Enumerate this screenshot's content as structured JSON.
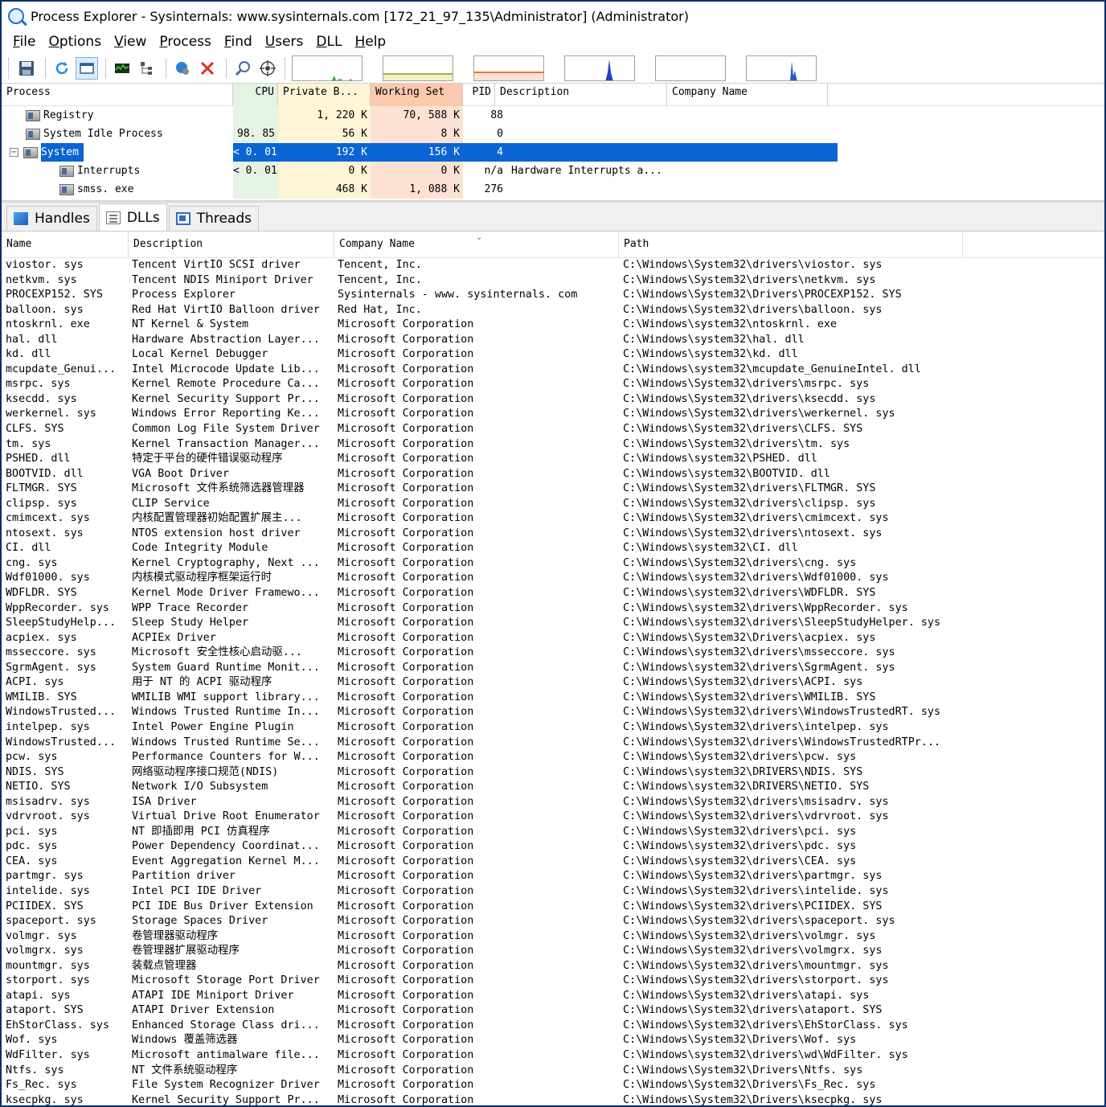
{
  "window": {
    "title": "Process Explorer - Sysinternals: www.sysinternals.com [172_21_97_135\\Administrator] (Administrator)"
  },
  "menu": [
    "File",
    "Options",
    "View",
    "Process",
    "Find",
    "Users",
    "DLL",
    "Help"
  ],
  "toolbar": {
    "icons": [
      "save-icon",
      "refresh-icon",
      "window-icon",
      "system-info-icon",
      "tree-icon",
      "properties-icon",
      "kill-process-icon",
      "find-icon",
      "target-icon"
    ]
  },
  "process_table": {
    "columns": [
      "Process",
      "CPU",
      "Private B...",
      "Working Set",
      "PID",
      "Description",
      "Company Name"
    ],
    "rows": [
      {
        "name": "Registry",
        "cpu": "",
        "private": "1, 220  K",
        "ws": "70, 588  K",
        "pid": "88",
        "desc": "",
        "company": "",
        "indent": 1,
        "selected": false,
        "expander": ""
      },
      {
        "name": "System Idle Process",
        "cpu": "98. 85",
        "private": "56  K",
        "ws": "8  K",
        "pid": "0",
        "desc": "",
        "company": "",
        "indent": 1,
        "selected": false,
        "expander": ""
      },
      {
        "name": "System",
        "cpu": "< 0. 01",
        "private": "192  K",
        "ws": "156  K",
        "pid": "4",
        "desc": "",
        "company": "",
        "indent": 1,
        "selected": true,
        "expander": "−"
      },
      {
        "name": "Interrupts",
        "cpu": "< 0. 01",
        "private": "0  K",
        "ws": "0  K",
        "pid": "n/a",
        "desc": "Hardware Interrupts a...",
        "company": "",
        "indent": 2,
        "selected": false,
        "expander": ""
      },
      {
        "name": "smss. exe",
        "cpu": "",
        "private": "468  K",
        "ws": "1, 088  K",
        "pid": "276",
        "desc": "",
        "company": "",
        "indent": 2,
        "selected": false,
        "expander": ""
      }
    ]
  },
  "tabs": [
    {
      "label": "Handles",
      "active": false
    },
    {
      "label": "DLLs",
      "active": true
    },
    {
      "label": "Threads",
      "active": false
    }
  ],
  "dll_table": {
    "columns": [
      "Name",
      "Description",
      "Company Name",
      "Path"
    ],
    "rows": [
      [
        "viostor. sys",
        "Tencent VirtIO SCSI driver",
        "Tencent,  Inc.",
        "C:\\Windows\\System32\\drivers\\viostor. sys"
      ],
      [
        "netkvm. sys",
        "Tencent NDIS Miniport Driver",
        "Tencent,  Inc.",
        "C:\\Windows\\System32\\drivers\\netkvm. sys"
      ],
      [
        "PROCEXP152. SYS",
        "Process Explorer",
        "Sysinternals - www. sysinternals. com",
        "C:\\Windows\\System32\\Drivers\\PROCEXP152. SYS"
      ],
      [
        "balloon. sys",
        "Red Hat VirtIO Balloon driver",
        "Red Hat,  Inc.",
        "C:\\Windows\\System32\\drivers\\balloon. sys"
      ],
      [
        "ntoskrnl. exe",
        "NT Kernel & System",
        "Microsoft Corporation",
        "C:\\Windows\\system32\\ntoskrnl. exe"
      ],
      [
        "hal. dll",
        "Hardware Abstraction Layer...",
        "Microsoft Corporation",
        "C:\\Windows\\system32\\hal. dll"
      ],
      [
        "kd. dll",
        "Local Kernel Debugger",
        "Microsoft Corporation",
        "C:\\Windows\\system32\\kd. dll"
      ],
      [
        "mcupdate_Genui...",
        "Intel Microcode Update Lib...",
        "Microsoft Corporation",
        "C:\\Windows\\system32\\mcupdate_GenuineIntel. dll"
      ],
      [
        "msrpc. sys",
        "Kernel Remote Procedure Ca...",
        "Microsoft Corporation",
        "C:\\Windows\\System32\\drivers\\msrpc. sys"
      ],
      [
        "ksecdd. sys",
        "Kernel Security Support Pr...",
        "Microsoft Corporation",
        "C:\\Windows\\System32\\drivers\\ksecdd. sys"
      ],
      [
        "werkernel. sys",
        "Windows Error Reporting Ke...",
        "Microsoft Corporation",
        "C:\\Windows\\System32\\drivers\\werkernel. sys"
      ],
      [
        "CLFS. SYS",
        "Common Log File System Driver",
        "Microsoft Corporation",
        "C:\\Windows\\System32\\drivers\\CLFS. SYS"
      ],
      [
        "tm. sys",
        "Kernel Transaction Manager...",
        "Microsoft Corporation",
        "C:\\Windows\\System32\\drivers\\tm. sys"
      ],
      [
        "PSHED. dll",
        "特定于平台的硬件错误驱动程序",
        "Microsoft Corporation",
        "C:\\Windows\\system32\\PSHED. dll"
      ],
      [
        "BOOTVID. dll",
        "VGA Boot Driver",
        "Microsoft Corporation",
        "C:\\Windows\\system32\\BOOTVID. dll"
      ],
      [
        "FLTMGR. SYS",
        "Microsoft 文件系统筛选器管理器",
        "Microsoft Corporation",
        "C:\\Windows\\System32\\drivers\\FLTMGR. SYS"
      ],
      [
        "clipsp. sys",
        "CLIP Service",
        "Microsoft Corporation",
        "C:\\Windows\\System32\\drivers\\clipsp. sys"
      ],
      [
        "cmimcext. sys",
        "内核配置管理器初始配置扩展主...",
        "Microsoft Corporation",
        "C:\\Windows\\System32\\drivers\\cmimcext. sys"
      ],
      [
        "ntosext. sys",
        "NTOS extension host driver",
        "Microsoft Corporation",
        "C:\\Windows\\System32\\drivers\\ntosext. sys"
      ],
      [
        "CI. dll",
        "Code Integrity Module",
        "Microsoft Corporation",
        "C:\\Windows\\system32\\CI. dll"
      ],
      [
        "cng. sys",
        "Kernel Cryptography,  Next ...",
        "Microsoft Corporation",
        "C:\\Windows\\System32\\drivers\\cng. sys"
      ],
      [
        "Wdf01000. sys",
        "内核模式驱动程序框架运行时",
        "Microsoft Corporation",
        "C:\\Windows\\system32\\drivers\\Wdf01000. sys"
      ],
      [
        "WDFLDR. SYS",
        "Kernel Mode Driver Framewo...",
        "Microsoft Corporation",
        "C:\\Windows\\system32\\drivers\\WDFLDR. SYS"
      ],
      [
        "WppRecorder. sys",
        "WPP Trace Recorder",
        "Microsoft Corporation",
        "C:\\Windows\\system32\\drivers\\WppRecorder. sys"
      ],
      [
        "SleepStudyHelp...",
        "Sleep Study Helper",
        "Microsoft Corporation",
        "C:\\Windows\\system32\\drivers\\SleepStudyHelper. sys"
      ],
      [
        "acpiex. sys",
        "ACPIEx Driver",
        "Microsoft Corporation",
        "C:\\Windows\\System32\\Drivers\\acpiex. sys"
      ],
      [
        "msseccore. sys",
        "Microsoft 安全性核心启动驱...",
        "Microsoft Corporation",
        "C:\\Windows\\system32\\drivers\\msseccore. sys"
      ],
      [
        "SgrmAgent. sys",
        "System Guard Runtime Monit...",
        "Microsoft Corporation",
        "C:\\Windows\\system32\\drivers\\SgrmAgent. sys"
      ],
      [
        "ACPI. sys",
        "用于 NT 的 ACPI 驱动程序",
        "Microsoft Corporation",
        "C:\\Windows\\System32\\drivers\\ACPI. sys"
      ],
      [
        "WMILIB. SYS",
        "WMILIB WMI support library...",
        "Microsoft Corporation",
        "C:\\Windows\\System32\\drivers\\WMILIB. SYS"
      ],
      [
        "WindowsTrusted...",
        "Windows Trusted Runtime In...",
        "Microsoft Corporation",
        "C:\\Windows\\System32\\drivers\\WindowsTrustedRT. sys"
      ],
      [
        "intelpep. sys",
        "Intel Power Engine Plugin",
        "Microsoft Corporation",
        "C:\\Windows\\System32\\drivers\\intelpep. sys"
      ],
      [
        "WindowsTrusted...",
        "Windows Trusted Runtime Se...",
        "Microsoft Corporation",
        "C:\\Windows\\System32\\drivers\\WindowsTrustedRTPr..."
      ],
      [
        "pcw. sys",
        "Performance Counters for W...",
        "Microsoft Corporation",
        "C:\\Windows\\System32\\drivers\\pcw. sys"
      ],
      [
        "NDIS. SYS",
        "网络驱动程序接口规范(NDIS)",
        "Microsoft Corporation",
        "C:\\Windows\\system32\\DRIVERS\\NDIS. SYS"
      ],
      [
        "NETIO. SYS",
        "Network I/O Subsystem",
        "Microsoft Corporation",
        "C:\\Windows\\system32\\DRIVERS\\NETIO. SYS"
      ],
      [
        "msisadrv. sys",
        "ISA Driver",
        "Microsoft Corporation",
        "C:\\Windows\\System32\\drivers\\msisadrv. sys"
      ],
      [
        "vdrvroot. sys",
        "Virtual Drive Root Enumerator",
        "Microsoft Corporation",
        "C:\\Windows\\System32\\drivers\\vdrvroot. sys"
      ],
      [
        "pci. sys",
        "NT 即插即用 PCI 仿真程序",
        "Microsoft Corporation",
        "C:\\Windows\\System32\\drivers\\pci. sys"
      ],
      [
        "pdc. sys",
        "Power Dependency Coordinat...",
        "Microsoft Corporation",
        "C:\\Windows\\system32\\drivers\\pdc. sys"
      ],
      [
        "CEA. sys",
        "Event Aggregation Kernel M...",
        "Microsoft Corporation",
        "C:\\Windows\\system32\\drivers\\CEA. sys"
      ],
      [
        "partmgr. sys",
        "Partition driver",
        "Microsoft Corporation",
        "C:\\Windows\\System32\\drivers\\partmgr. sys"
      ],
      [
        "intelide. sys",
        "Intel PCI IDE Driver",
        "Microsoft Corporation",
        "C:\\Windows\\System32\\drivers\\intelide. sys"
      ],
      [
        "PCIIDEX. SYS",
        "PCI IDE Bus Driver Extension",
        "Microsoft Corporation",
        "C:\\Windows\\System32\\drivers\\PCIIDEX. SYS"
      ],
      [
        "spaceport. sys",
        "Storage Spaces Driver",
        "Microsoft Corporation",
        "C:\\Windows\\System32\\drivers\\spaceport. sys"
      ],
      [
        "volmgr. sys",
        "卷管理器驱动程序",
        "Microsoft Corporation",
        "C:\\Windows\\System32\\drivers\\volmgr. sys"
      ],
      [
        "volmgrx. sys",
        "卷管理器扩展驱动程序",
        "Microsoft Corporation",
        "C:\\Windows\\System32\\drivers\\volmgrx. sys"
      ],
      [
        "mountmgr. sys",
        "装载点管理器",
        "Microsoft Corporation",
        "C:\\Windows\\System32\\drivers\\mountmgr. sys"
      ],
      [
        "storport. sys",
        "Microsoft Storage Port Driver",
        "Microsoft Corporation",
        "C:\\Windows\\System32\\drivers\\storport. sys"
      ],
      [
        "atapi. sys",
        "ATAPI IDE Miniport Driver",
        "Microsoft Corporation",
        "C:\\Windows\\System32\\drivers\\atapi. sys"
      ],
      [
        "ataport. SYS",
        "ATAPI Driver Extension",
        "Microsoft Corporation",
        "C:\\Windows\\System32\\drivers\\ataport. SYS"
      ],
      [
        "EhStorClass. sys",
        "Enhanced Storage Class dri...",
        "Microsoft Corporation",
        "C:\\Windows\\System32\\drivers\\EhStorClass. sys"
      ],
      [
        "Wof. sys",
        "Windows 覆盖筛选器",
        "Microsoft Corporation",
        "C:\\Windows\\System32\\Drivers\\Wof. sys"
      ],
      [
        "WdFilter. sys",
        "Microsoft antimalware file...",
        "Microsoft Corporation",
        "C:\\Windows\\system32\\drivers\\wd\\WdFilter. sys"
      ],
      [
        "Ntfs. sys",
        "NT 文件系统驱动程序",
        "Microsoft Corporation",
        "C:\\Windows\\System32\\Drivers\\Ntfs. sys"
      ],
      [
        "Fs_Rec. sys",
        "File System Recognizer Driver",
        "Microsoft Corporation",
        "C:\\Windows\\System32\\Drivers\\Fs_Rec. sys"
      ],
      [
        "ksecpkg. sys",
        "Kernel Security Support Pr...",
        "Microsoft Corporation",
        "C:\\Windows\\System32\\Drivers\\ksecpkg. sys"
      ]
    ]
  }
}
